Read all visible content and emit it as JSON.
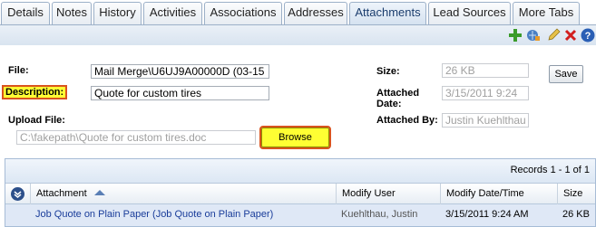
{
  "tabs": [
    {
      "label": "Details",
      "active": false
    },
    {
      "label": "Notes",
      "active": false
    },
    {
      "label": "History",
      "active": false
    },
    {
      "label": "Activities",
      "active": false
    },
    {
      "label": "Associations",
      "active": false
    },
    {
      "label": "Addresses",
      "active": false
    },
    {
      "label": "Attachments",
      "active": true
    },
    {
      "label": "Lead Sources",
      "active": false
    },
    {
      "label": "More Tabs",
      "active": false
    }
  ],
  "toolbar": {
    "icons": [
      "add-icon",
      "add-url-icon",
      "edit-icon",
      "delete-icon",
      "help-icon"
    ]
  },
  "form": {
    "file_label": "File:",
    "file_value": "Mail Merge\\U6UJ9A00000D (03-15",
    "description_label": "Description:",
    "description_value": "Quote for custom tires",
    "upload_label": "Upload File:",
    "upload_value": "C:\\fakepath\\Quote for custom tires.doc",
    "browse_label": "Browse",
    "size_label": "Size:",
    "size_value": "26 KB",
    "attached_date_label_1": "Attached",
    "attached_date_label_2": "Date:",
    "attached_date_value": "3/15/2011 9:24",
    "attached_by_label": "Attached By:",
    "attached_by_value": "Justin Kuehlthau",
    "save_label": "Save"
  },
  "grid": {
    "records_text": "Records 1 - 1 of 1",
    "columns": [
      "Attachment",
      "Modify User",
      "Modify Date/Time",
      "Size"
    ],
    "rows": [
      {
        "attachment": "Job Quote on Plain Paper (Job Quote on Plain Paper)",
        "modify_user": "Kuehlthau, Justin",
        "modify_date": "3/15/2011 9:24 AM",
        "size": "26 KB"
      }
    ]
  },
  "colors": {
    "highlight": "#ffff33",
    "highlight_border": "#d9531e",
    "link": "#1a3d9a",
    "active_tab": "#d5e2f0"
  }
}
